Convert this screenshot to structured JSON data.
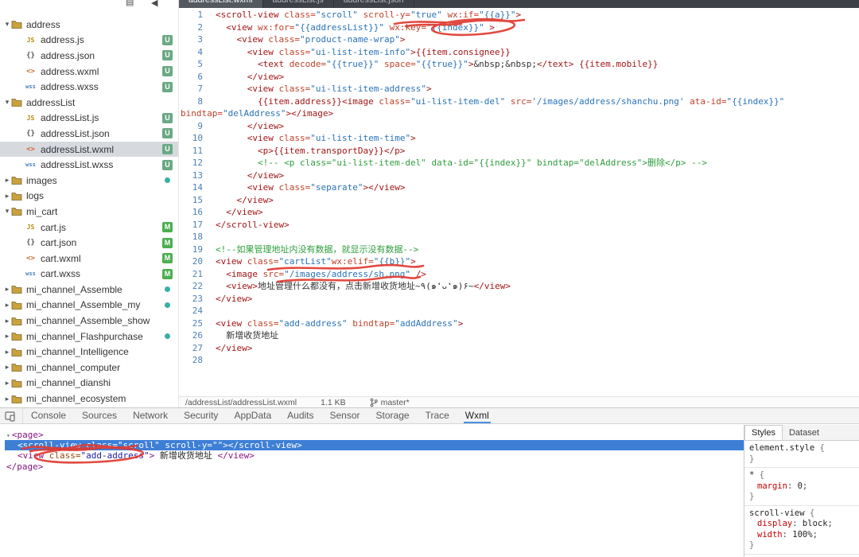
{
  "colors": {
    "selection_blue": "#3e7fd6",
    "annotation_red": "#e03a2f",
    "badge_untracked_green": "#6aa984",
    "badge_modified_green": "#4caf50",
    "active_tab_underline": "#4a90e2",
    "string_blue": "#2973b7",
    "tag_red": "#a31515",
    "comment_green": "#2e9e3c"
  },
  "top_tabs": {
    "items": [
      {
        "label": "addressList.wxml",
        "active": true
      },
      {
        "label": "addressList.js",
        "active": false
      },
      {
        "label": "addressList.json",
        "active": false
      }
    ]
  },
  "sidebar": {
    "items": [
      {
        "t": "folder",
        "label": "address",
        "expanded": true
      },
      {
        "t": "file",
        "icon": "js",
        "label": "address.js",
        "badge": "U"
      },
      {
        "t": "file",
        "icon": "json",
        "label": "address.json",
        "badge": "U"
      },
      {
        "t": "file",
        "icon": "wxml",
        "label": "address.wxml",
        "badge": "U"
      },
      {
        "t": "file",
        "icon": "wxss",
        "label": "address.wxss",
        "badge": "U"
      },
      {
        "t": "folder",
        "label": "addressList",
        "expanded": true
      },
      {
        "t": "file",
        "icon": "js",
        "label": "addressList.js",
        "badge": "U"
      },
      {
        "t": "file",
        "icon": "json",
        "label": "addressList.json",
        "badge": "U"
      },
      {
        "t": "file",
        "icon": "wxml",
        "label": "addressList.wxml",
        "badge": "U",
        "selected": true
      },
      {
        "t": "file",
        "icon": "wxss",
        "label": "addressList.wxss",
        "badge": "U"
      },
      {
        "t": "folder",
        "label": "images",
        "dot": true
      },
      {
        "t": "folder",
        "label": "logs"
      },
      {
        "t": "folder",
        "label": "mi_cart",
        "expanded": true
      },
      {
        "t": "file",
        "icon": "js",
        "label": "cart.js",
        "badge": "M"
      },
      {
        "t": "file",
        "icon": "json",
        "label": "cart.json",
        "badge": "M"
      },
      {
        "t": "file",
        "icon": "wxml",
        "label": "cart.wxml",
        "badge": "M"
      },
      {
        "t": "file",
        "icon": "wxss",
        "label": "cart.wxss",
        "badge": "M"
      },
      {
        "t": "folder",
        "label": "mi_channel_Assemble",
        "dot": true
      },
      {
        "t": "folder",
        "label": "mi_channel_Assemble_my",
        "dot": true
      },
      {
        "t": "folder",
        "label": "mi_channel_Assemble_show"
      },
      {
        "t": "folder",
        "label": "mi_channel_Flashpurchase",
        "dot": true
      },
      {
        "t": "folder",
        "label": "mi_channel_Intelligence"
      },
      {
        "t": "folder",
        "label": "mi_channel_computer"
      },
      {
        "t": "folder",
        "label": "mi_channel_dianshi"
      },
      {
        "t": "folder",
        "label": "mi_channel_ecosystem"
      }
    ]
  },
  "editor": {
    "lines": [
      {
        "n": "1",
        "s": [
          [
            "tg",
            "<scroll-view "
          ],
          [
            "at",
            "class="
          ],
          [
            "st",
            "\"scroll\""
          ],
          [
            "tx",
            " "
          ],
          [
            "at",
            "scroll-y="
          ],
          [
            "st",
            "\"true\""
          ],
          [
            "tx",
            " "
          ],
          [
            "at",
            "wx:if="
          ],
          [
            "st",
            "\"{{a}}\""
          ],
          [
            "tg",
            ">"
          ]
        ]
      },
      {
        "n": "2",
        "s": [
          [
            "tx",
            "  "
          ],
          [
            "tg",
            "<view "
          ],
          [
            "at",
            "wx:for="
          ],
          [
            "st",
            "\"{{addressList}}\""
          ],
          [
            "tx",
            " "
          ],
          [
            "at",
            "wx:key="
          ],
          [
            "st",
            "\"{{index}}\""
          ],
          [
            "tx",
            " "
          ],
          [
            "tg",
            ">"
          ]
        ]
      },
      {
        "n": "3",
        "s": [
          [
            "tx",
            "    "
          ],
          [
            "tg",
            "<view "
          ],
          [
            "at",
            "class="
          ],
          [
            "st",
            "\"product-name-wrap\""
          ],
          [
            "tg",
            ">"
          ]
        ]
      },
      {
        "n": "4",
        "s": [
          [
            "tx",
            "      "
          ],
          [
            "tg",
            "<view "
          ],
          [
            "at",
            "class="
          ],
          [
            "st",
            "\"ui-list-item-info\""
          ],
          [
            "tg",
            ">"
          ],
          [
            "mu",
            "{{item.consignee}}"
          ]
        ]
      },
      {
        "n": "5",
        "s": [
          [
            "tx",
            "        "
          ],
          [
            "tg",
            "<text "
          ],
          [
            "at",
            "decode="
          ],
          [
            "st",
            "\"{{true}}\""
          ],
          [
            "tx",
            " "
          ],
          [
            "at",
            "space="
          ],
          [
            "st",
            "\"{{true}}\""
          ],
          [
            "tg",
            ">"
          ],
          [
            "tx",
            "&nbsp;&nbsp;"
          ],
          [
            "tg",
            "</text>"
          ],
          [
            "tx",
            " "
          ],
          [
            "mu",
            "{{item.mobile}}"
          ]
        ]
      },
      {
        "n": "6",
        "s": [
          [
            "tx",
            "      "
          ],
          [
            "tg",
            "</view>"
          ]
        ]
      },
      {
        "n": "7",
        "s": [
          [
            "tx",
            "      "
          ],
          [
            "tg",
            "<view "
          ],
          [
            "at",
            "class="
          ],
          [
            "st",
            "\"ui-list-item-address\""
          ],
          [
            "tg",
            ">"
          ]
        ]
      },
      {
        "n": "8",
        "s": [
          [
            "tx",
            "        "
          ],
          [
            "mu",
            "{{item.address}}"
          ],
          [
            "tg",
            "<image "
          ],
          [
            "at",
            "class="
          ],
          [
            "st",
            "\"ui-list-item-del\""
          ],
          [
            "tx",
            " "
          ],
          [
            "at",
            "src="
          ],
          [
            "st",
            "'/images/address/shanchu.png'"
          ],
          [
            "tx",
            " "
          ],
          [
            "at",
            "ata-id="
          ],
          [
            "st",
            "\"{{index}}\""
          ]
        ]
      },
      {
        "n": "",
        "flush": true,
        "s": [
          [
            "at",
            "bindtap="
          ],
          [
            "st",
            "\"delAddress\""
          ],
          [
            "tg",
            "></image>"
          ]
        ]
      },
      {
        "n": "9",
        "s": [
          [
            "tx",
            "      "
          ],
          [
            "tg",
            "</view>"
          ]
        ]
      },
      {
        "n": "10",
        "s": [
          [
            "tx",
            "      "
          ],
          [
            "tg",
            "<view "
          ],
          [
            "at",
            "class="
          ],
          [
            "st",
            "\"ui-list-item-time\""
          ],
          [
            "tg",
            ">"
          ]
        ]
      },
      {
        "n": "11",
        "s": [
          [
            "tx",
            "        "
          ],
          [
            "tg",
            "<p>"
          ],
          [
            "mu",
            "{{item.transportDay}}"
          ],
          [
            "tg",
            "</p>"
          ]
        ]
      },
      {
        "n": "12",
        "s": [
          [
            "tx",
            "        "
          ],
          [
            "cm",
            "<!-- <p class=\"ui-list-item-del\" data-id=\"{{index}}\" bindtap=\"delAddress\">删除</p> -->"
          ]
        ]
      },
      {
        "n": "13",
        "s": [
          [
            "tx",
            "      "
          ],
          [
            "tg",
            "</view>"
          ]
        ]
      },
      {
        "n": "14",
        "s": [
          [
            "tx",
            "      "
          ],
          [
            "tg",
            "<view "
          ],
          [
            "at",
            "class="
          ],
          [
            "st",
            "\"separate\""
          ],
          [
            "tg",
            "></view>"
          ]
        ]
      },
      {
        "n": "15",
        "s": [
          [
            "tx",
            "    "
          ],
          [
            "tg",
            "</view>"
          ]
        ]
      },
      {
        "n": "16",
        "s": [
          [
            "tx",
            "  "
          ],
          [
            "tg",
            "</view>"
          ]
        ]
      },
      {
        "n": "17",
        "s": [
          [
            "tg",
            "</scroll-view>"
          ]
        ]
      },
      {
        "n": "18",
        "s": []
      },
      {
        "n": "19",
        "s": [
          [
            "cm",
            "<!--如果管理地址内没有数据，就显示没有数据-->"
          ]
        ]
      },
      {
        "n": "20",
        "s": [
          [
            "tg",
            "<view "
          ],
          [
            "at",
            "class="
          ],
          [
            "st",
            "\"cartList\""
          ],
          [
            "at",
            "wx:elif="
          ],
          [
            "st",
            "\"{{b}}\""
          ],
          [
            "tg",
            ">"
          ]
        ]
      },
      {
        "n": "21",
        "s": [
          [
            "tx",
            "  "
          ],
          [
            "tg",
            "<image "
          ],
          [
            "at",
            "src="
          ],
          [
            "st",
            "\"/images/address/sh.png\""
          ],
          [
            "tx",
            " "
          ],
          [
            "tg",
            "/>"
          ]
        ]
      },
      {
        "n": "22",
        "s": [
          [
            "tx",
            "  "
          ],
          [
            "tg",
            "<view>"
          ],
          [
            "tx",
            "地址管理什么都没有，点击新增收货地址~٩(๑❛ᴗ❛๑)۶~"
          ],
          [
            "tg",
            "</view>"
          ]
        ]
      },
      {
        "n": "23",
        "s": [
          [
            "tg",
            "</view>"
          ]
        ]
      },
      {
        "n": "24",
        "s": []
      },
      {
        "n": "25",
        "s": [
          [
            "tg",
            "<view "
          ],
          [
            "at",
            "class="
          ],
          [
            "st",
            "\"add-address\""
          ],
          [
            "tx",
            " "
          ],
          [
            "at",
            "bindtap="
          ],
          [
            "st",
            "\"addAddress\""
          ],
          [
            "tg",
            ">"
          ]
        ]
      },
      {
        "n": "26",
        "s": [
          [
            "tx",
            "  新增收货地址"
          ]
        ]
      },
      {
        "n": "27",
        "s": [
          [
            "tg",
            "</view>"
          ]
        ]
      },
      {
        "n": "28",
        "s": []
      }
    ],
    "footer": {
      "path": "/addressList/addressList.wxml",
      "size": "1.1 KB",
      "branch": "master*"
    }
  },
  "devtools": {
    "tabs": [
      {
        "label": "Console"
      },
      {
        "label": "Sources"
      },
      {
        "label": "Network"
      },
      {
        "label": "Security"
      },
      {
        "label": "AppData"
      },
      {
        "label": "Audits"
      },
      {
        "label": "Sensor"
      },
      {
        "label": "Storage"
      },
      {
        "label": "Trace"
      },
      {
        "label": "Wxml",
        "active": true
      }
    ],
    "tree": [
      {
        "indent": 0,
        "arrow": "▾",
        "segs": [
          [
            "tag",
            "<page>"
          ]
        ]
      },
      {
        "indent": 1,
        "selected": true,
        "segs": [
          [
            "sel",
            "<scroll-view class=\"scroll\" scroll-y=\"\"></scroll-view>"
          ]
        ]
      },
      {
        "indent": 1,
        "segs": [
          [
            "tag",
            "<view"
          ],
          [
            "attr",
            " class="
          ],
          [
            "val",
            "\"add-address\""
          ],
          [
            "tag",
            ">"
          ],
          [
            "txt",
            " 新增收货地址 "
          ],
          [
            "tag",
            "</view>"
          ]
        ]
      },
      {
        "indent": 0,
        "segs": [
          [
            "tag",
            "</page>"
          ]
        ]
      }
    ],
    "styles": {
      "tabs": [
        {
          "label": "Styles",
          "active": true
        },
        {
          "label": "Dataset"
        }
      ],
      "rules": [
        {
          "selector": "element.style",
          "props": []
        },
        {
          "selector": "*",
          "props": [
            [
              "margin",
              "0"
            ]
          ]
        },
        {
          "selector": "scroll-view",
          "props": [
            [
              "display",
              "block"
            ],
            [
              "width",
              "100%"
            ]
          ]
        }
      ]
    }
  }
}
